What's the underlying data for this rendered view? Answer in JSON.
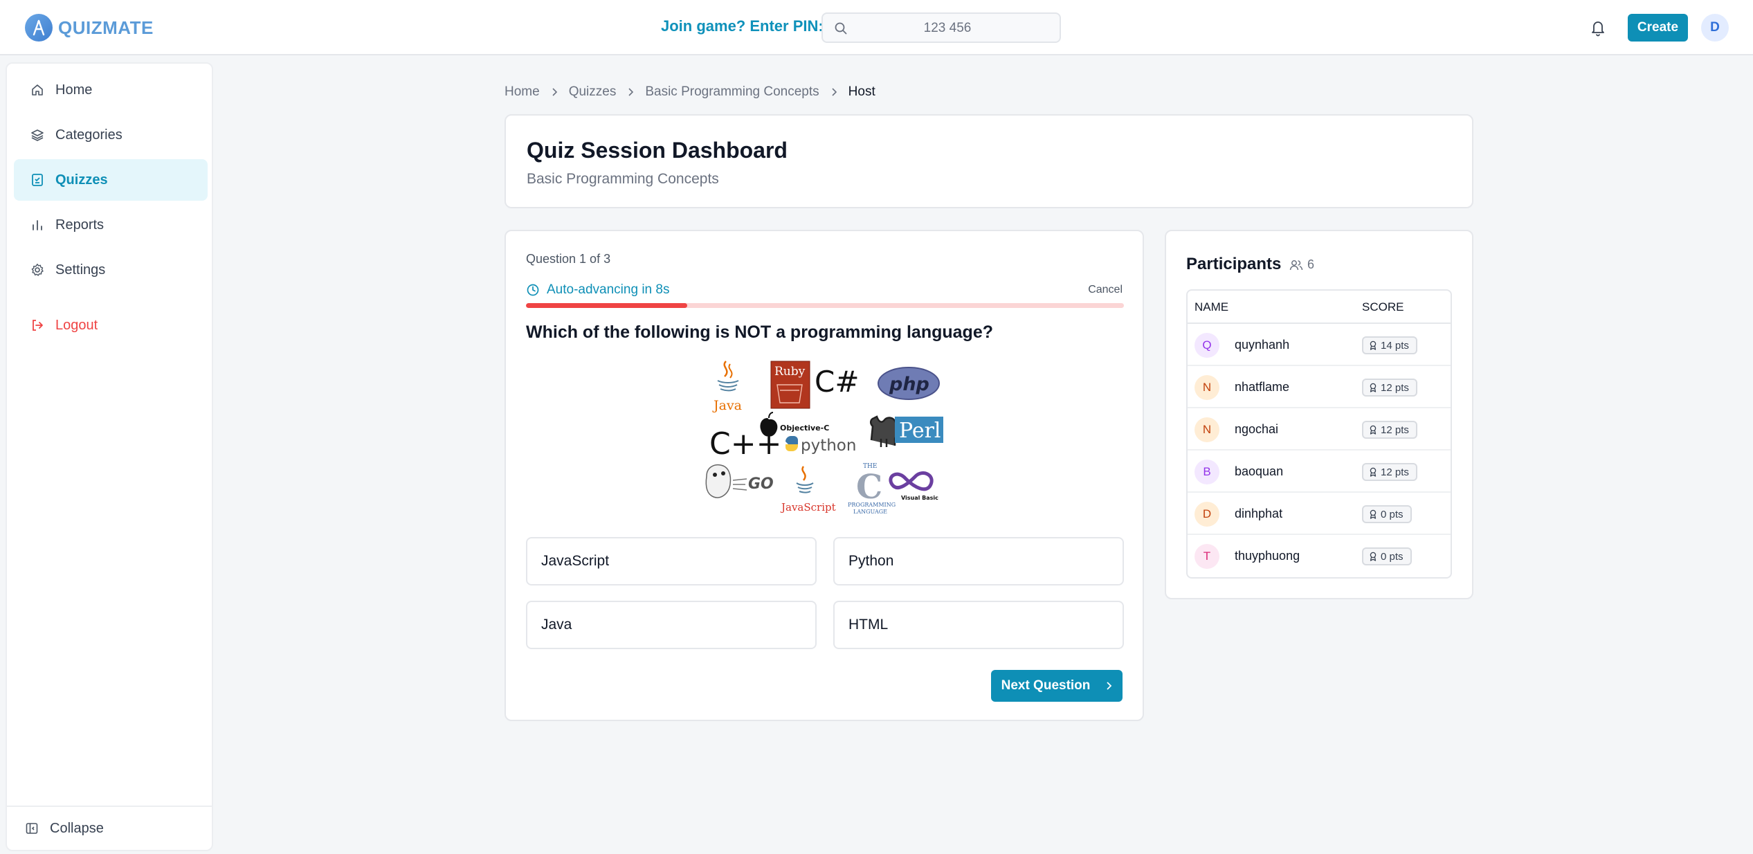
{
  "app": {
    "logo_text": "QUIZMATE",
    "accent": "#0e8fb6"
  },
  "header": {
    "pin_label": "Join game? Enter PIN:",
    "pin_placeholder": "123 456",
    "create_label": "Create",
    "avatar_initial": "D"
  },
  "sidebar": {
    "items": [
      {
        "label": "Home",
        "icon": "home-icon"
      },
      {
        "label": "Categories",
        "icon": "layers-icon"
      },
      {
        "label": "Quizzes",
        "icon": "clipboard-icon",
        "active": true
      },
      {
        "label": "Reports",
        "icon": "bar-chart-icon"
      },
      {
        "label": "Settings",
        "icon": "gear-icon"
      }
    ],
    "logout_label": "Logout",
    "collapse_label": "Collapse"
  },
  "breadcrumb": [
    "Home",
    "Quizzes",
    "Basic Programming Concepts",
    "Host"
  ],
  "page": {
    "title": "Quiz Session Dashboard",
    "subtitle": "Basic Programming Concepts"
  },
  "question": {
    "counter": "Question 1 of 3",
    "auto_advance": "Auto-advancing in 8s",
    "cancel_label": "Cancel",
    "progress": 0.27,
    "text": "Which of the following is NOT a programming language?",
    "image_labels": [
      "Java",
      "Ruby",
      "C#",
      "php",
      "C++",
      "Objective-C",
      "python",
      "Perl",
      "GO",
      "JavaScript",
      "THE",
      "C",
      "PROGRAMMING",
      "LANGUAGE",
      "Visual Basic"
    ],
    "answers": [
      "JavaScript",
      "Python",
      "Java",
      "HTML"
    ],
    "next_label": "Next Question"
  },
  "participants": {
    "title": "Participants",
    "count": "6",
    "col_name": "NAME",
    "col_score": "SCORE",
    "rows": [
      {
        "initial": "Q",
        "name": "quynhanh",
        "score": "14 pts",
        "bg": "#f3e8ff",
        "fg": "#9333ea"
      },
      {
        "initial": "N",
        "name": "nhatflame",
        "score": "12 pts",
        "bg": "#ffedd5",
        "fg": "#c2410c"
      },
      {
        "initial": "N",
        "name": "ngochai",
        "score": "12 pts",
        "bg": "#ffedd5",
        "fg": "#c2410c"
      },
      {
        "initial": "B",
        "name": "baoquan",
        "score": "12 pts",
        "bg": "#f3e8ff",
        "fg": "#9333ea"
      },
      {
        "initial": "D",
        "name": "dinhphat",
        "score": "0 pts",
        "bg": "#ffedd5",
        "fg": "#c2410c"
      },
      {
        "initial": "T",
        "name": "thuyphuong",
        "score": "0 pts",
        "bg": "#fce7f3",
        "fg": "#db2777"
      }
    ]
  }
}
